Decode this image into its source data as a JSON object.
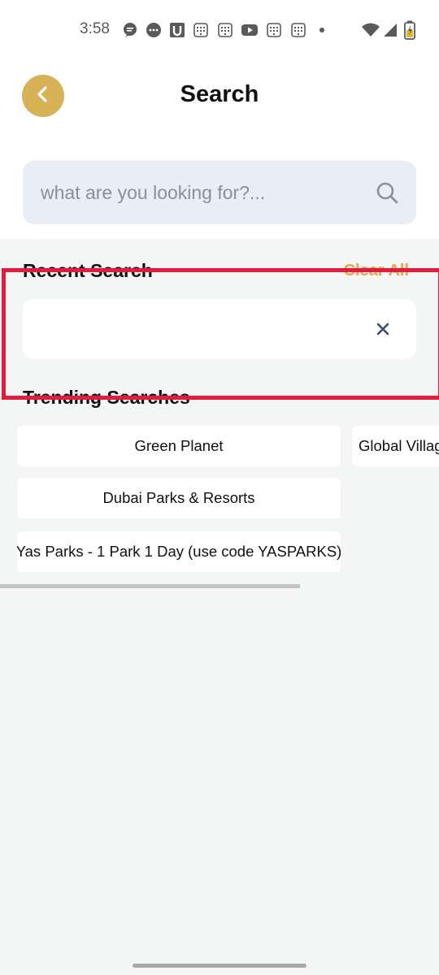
{
  "status_bar": {
    "time": "3:58",
    "left_icons": [
      "chat-bubble-icon",
      "messenger-icon",
      "u-app-icon",
      "calendar-icon",
      "calendar-icon",
      "youtube-icon",
      "calendar-icon",
      "calendar-icon",
      "dot-icon"
    ],
    "right_icons": [
      "wifi-icon",
      "signal-icon",
      "battery-charging-icon"
    ]
  },
  "header": {
    "title": "Search",
    "back_icon": "chevron-left-icon"
  },
  "search": {
    "placeholder": "what are you looking for?...",
    "value": "",
    "icon": "search-icon"
  },
  "recent": {
    "heading": "Recent Search",
    "clear_label": "Clear All",
    "items": [
      {
        "label": "",
        "remove_icon": "close-icon"
      }
    ]
  },
  "trending": {
    "heading": "Trending Searches",
    "chips": [
      "Green Planet",
      "Global Village",
      "Dubai Parks & Resorts",
      "Yas Parks - 1 Park 1 Day (use code YASPARKS)"
    ]
  },
  "colors": {
    "accent": "#d8b257",
    "clear_all": "#e5a64a",
    "search_bg": "#e9eef6",
    "page_bg": "#f4f5f5",
    "highlight": "#e21c3d",
    "close_icon": "#3a4f6b"
  }
}
